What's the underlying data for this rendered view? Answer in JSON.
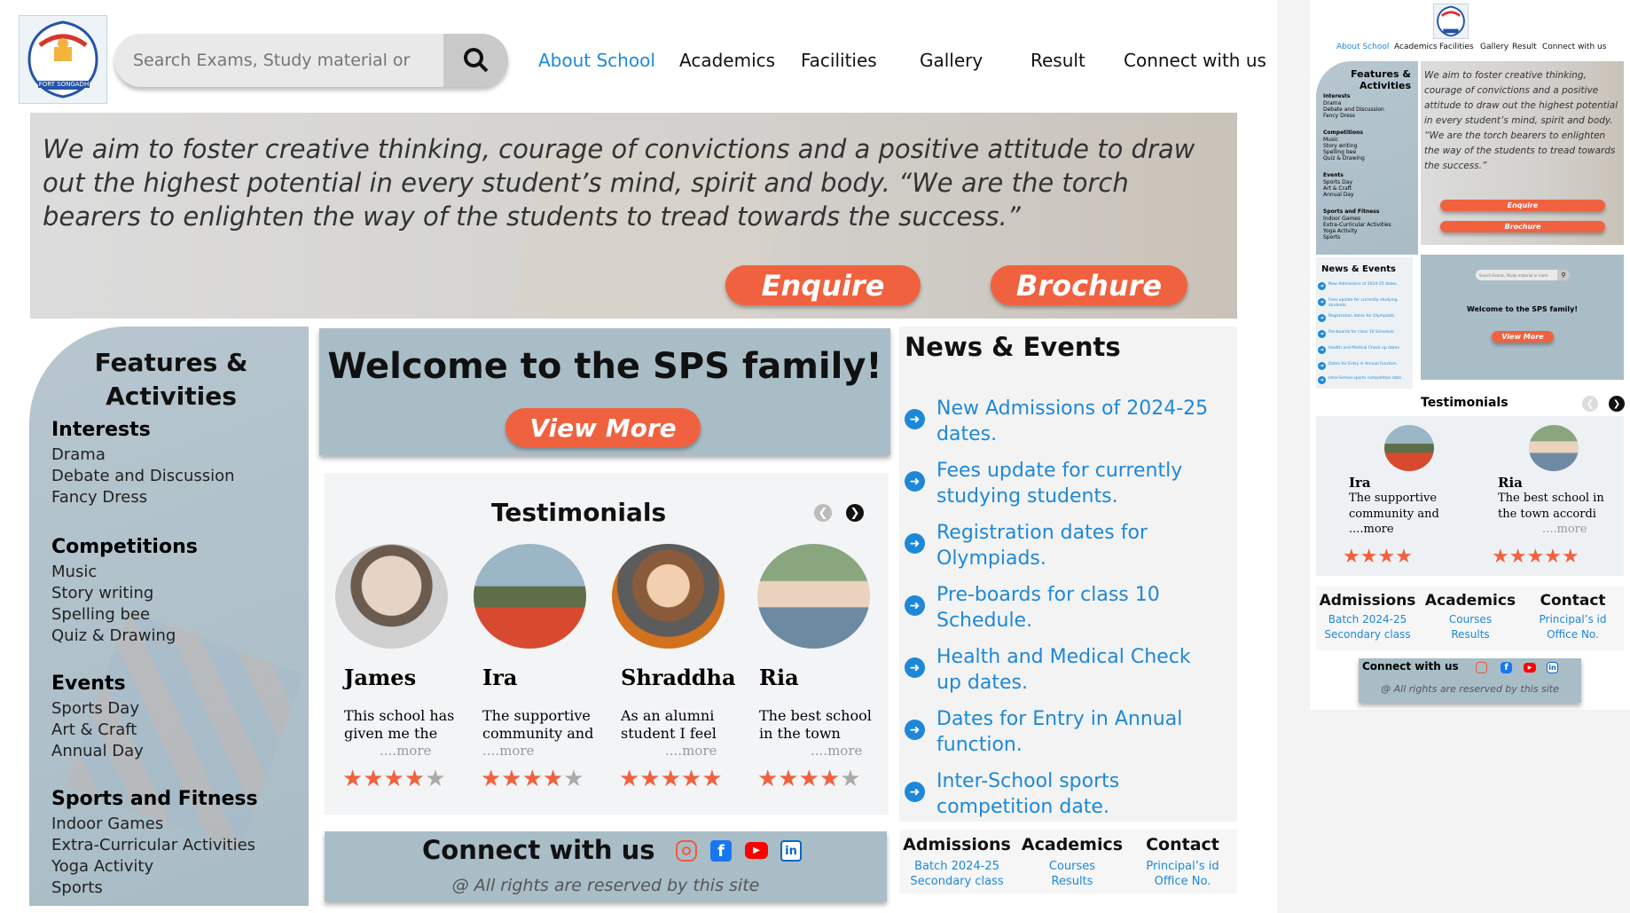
{
  "brand": {
    "logo_text": "FORT SONGADH"
  },
  "search": {
    "placeholder": "Search Exams, Study material or more"
  },
  "nav": [
    "About School",
    "Academics",
    "Facilities",
    "Gallery",
    "Result",
    "Connect with us"
  ],
  "hero": {
    "quote": "We aim to foster creative thinking, courage of convictions and a positive attitude to draw out the highest potential in every student’s mind, spirit and body. “We are the torch bearers to enlighten the way of the students to tread towards the success.”",
    "enquire": "Enquire",
    "brochure": "Brochure"
  },
  "features": {
    "title": "Features & Activities",
    "groups": [
      {
        "heading": "Interests",
        "items": [
          "Drama",
          "Debate and Discussion",
          "Fancy Dress"
        ]
      },
      {
        "heading": "Competitions",
        "items": [
          "Music",
          "Story writing",
          "Spelling bee",
          "Quiz & Drawing"
        ]
      },
      {
        "heading": "Events",
        "items": [
          "Sports Day",
          "Art & Craft",
          "Annual Day"
        ]
      },
      {
        "heading": "Sports and Fitness",
        "items": [
          "Indoor Games",
          "Extra-Curricular Activities",
          "Yoga Activity",
          "Sports"
        ]
      }
    ]
  },
  "welcome": {
    "title": "Welcome to the SPS family!",
    "button": "View More"
  },
  "testimonials": {
    "title": "Testimonials",
    "items": [
      {
        "name": "James",
        "text": "This school has given me the tools",
        "more": "....more",
        "rating": 4
      },
      {
        "name": "Ira",
        "text": "The supportive community and",
        "more": "....more",
        "rating": 4
      },
      {
        "name": "Shraddha",
        "text": "As an alumni student I feel proud",
        "more": "....more",
        "rating": 5
      },
      {
        "name": "Ria",
        "text": "The best school in the town accordi",
        "more": "....more",
        "rating": 4
      }
    ]
  },
  "news": {
    "title": "News & Events",
    "items": [
      "New Admissions of 2024-25 dates.",
      "Fees update for currently studying students.",
      "Registration dates for Olympiads.",
      "Pre-boards for class 10 Schedule.",
      "Health and Medical Check up dates.",
      "Dates for Entry in Annual function.",
      "Inter-School sports competition date."
    ]
  },
  "connect": {
    "title": "Connect with us",
    "rights": "@ All rights are reserved by this site"
  },
  "quick_links": [
    {
      "heading": "Admissions",
      "lines": [
        "Batch 2024-25",
        "Secondary class"
      ]
    },
    {
      "heading": "Academics",
      "lines": [
        "Courses",
        "Results"
      ]
    },
    {
      "heading": "Contact",
      "lines": [
        "Principal’s id",
        "Office No."
      ]
    }
  ],
  "mobile": {
    "testimonials": [
      {
        "name": "Ira",
        "text": "The supportive community and",
        "more": "....more"
      },
      {
        "name": "Ria",
        "text": "The best school in the town accordi",
        "more": "....more"
      }
    ]
  },
  "colors": {
    "accent": "#1e88d8",
    "button": "#f0623f",
    "panel": "#a9bdc7"
  }
}
